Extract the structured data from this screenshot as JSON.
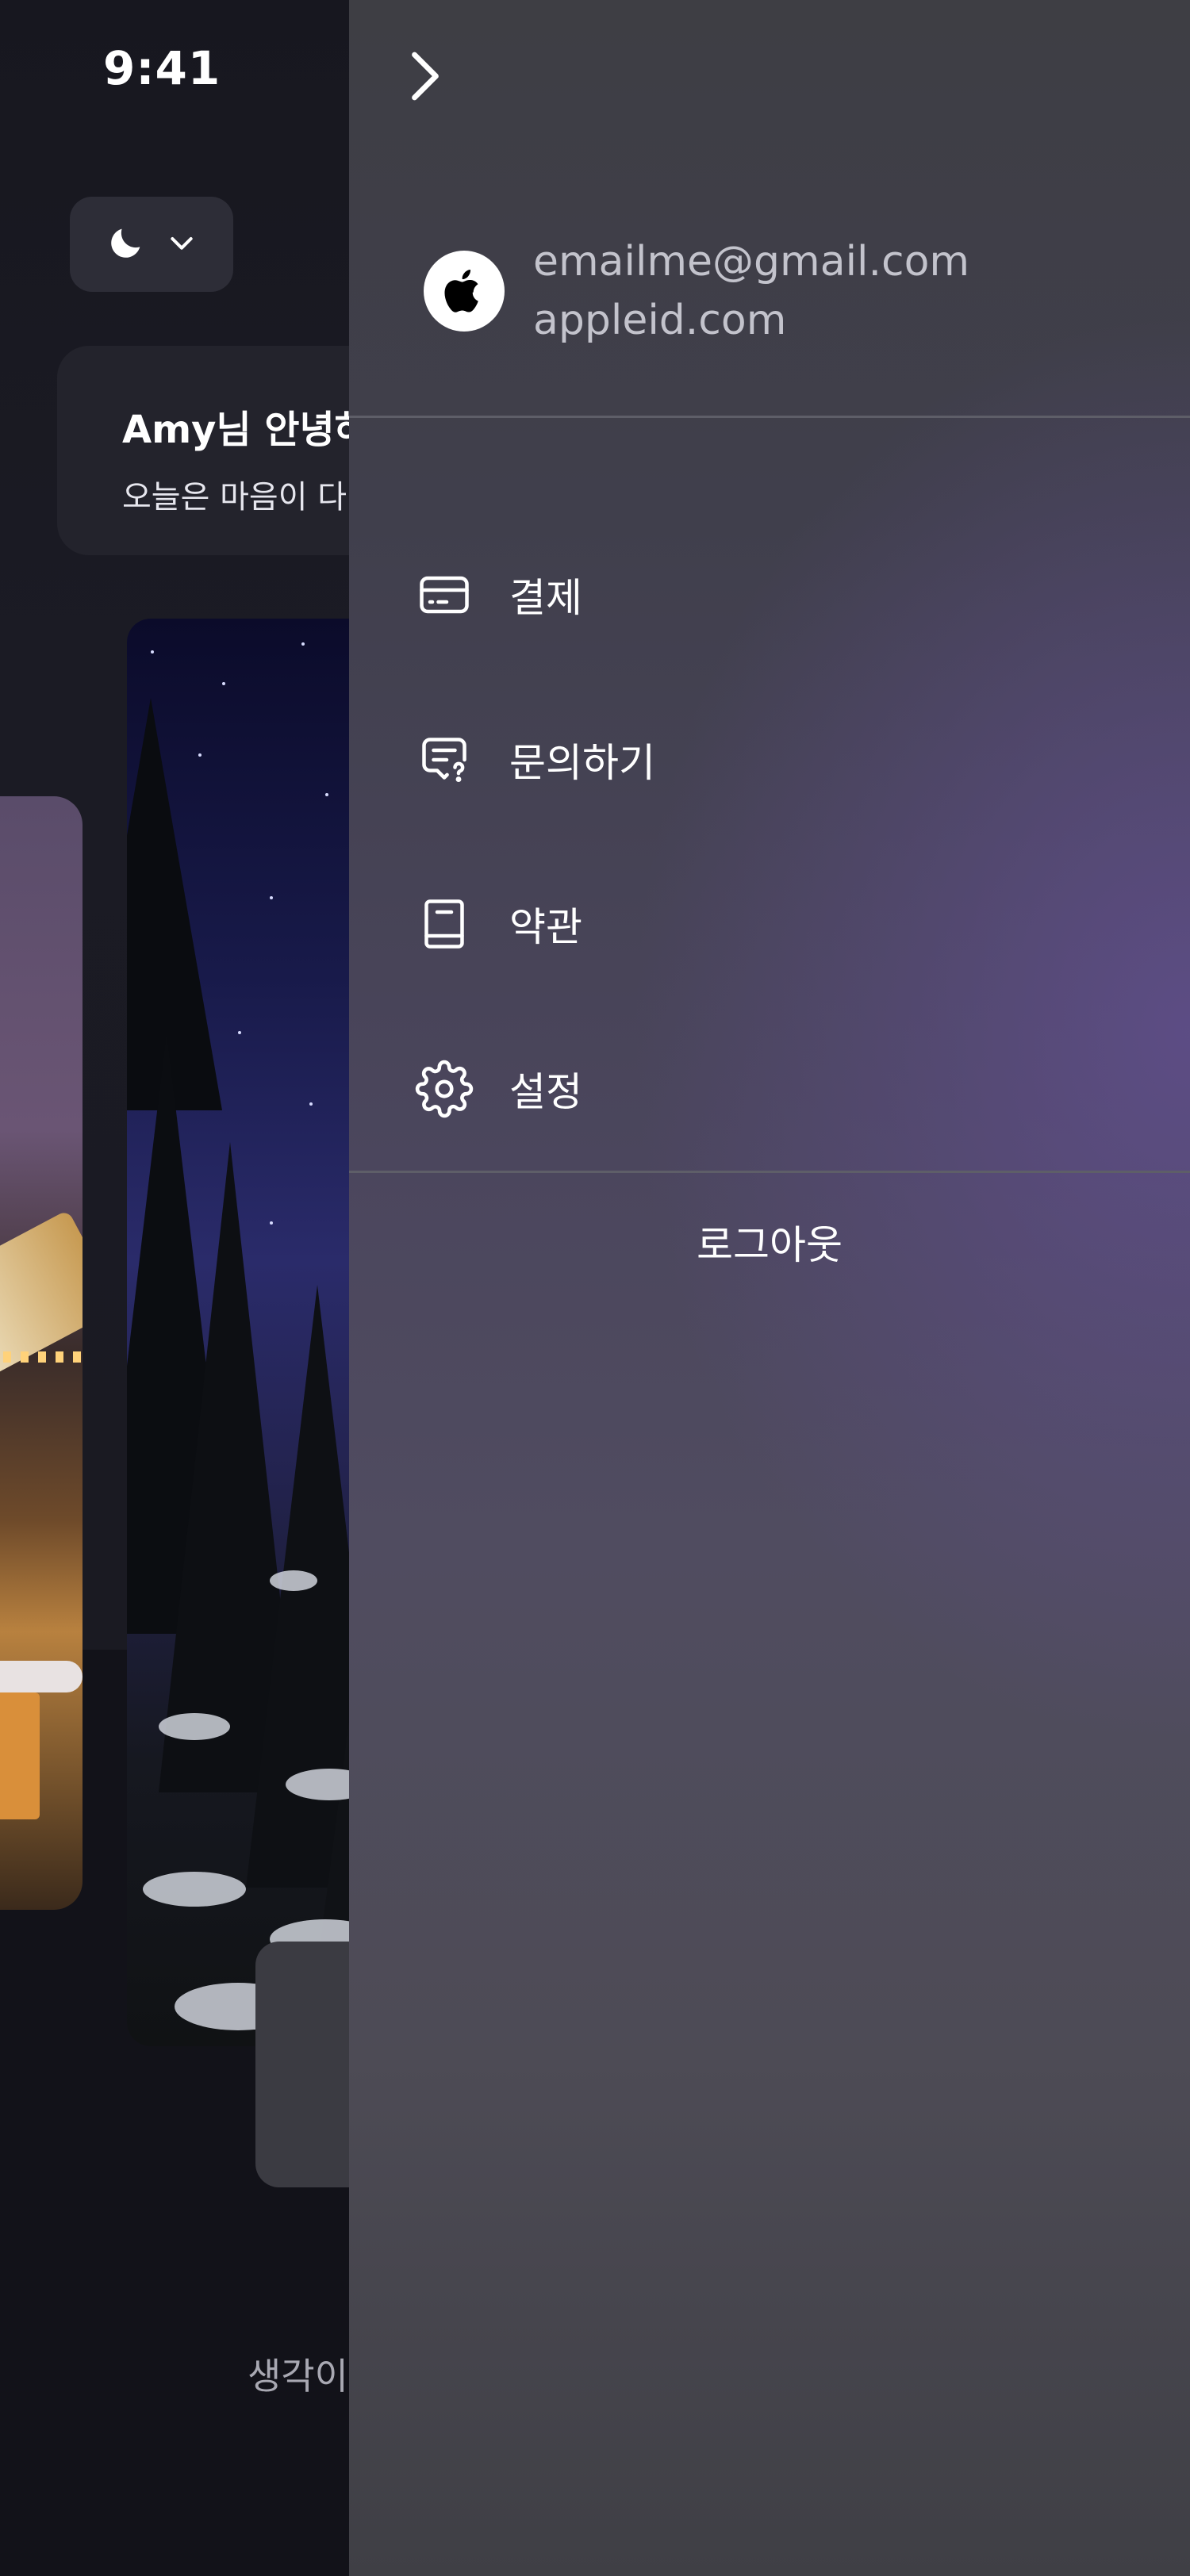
{
  "status_bar": {
    "time": "9:41"
  },
  "background": {
    "greeting_title": "Amy님 안녕하",
    "greeting_subtitle": "오늘은 마음이 다",
    "bottom_text": "생각이"
  },
  "drawer": {
    "account": {
      "email": "emailme@gmail.com",
      "domain": "appleid.com"
    },
    "menu": [
      {
        "label": "결제",
        "icon": "credit-card-icon"
      },
      {
        "label": "문의하기",
        "icon": "chat-question-icon"
      },
      {
        "label": "약관",
        "icon": "book-icon"
      },
      {
        "label": "설정",
        "icon": "gear-icon"
      }
    ],
    "logout_label": "로그아웃"
  },
  "colors": {
    "drawer_top": "#3e3e44",
    "drawer_accent": "#604e8c",
    "app_background": "#121219",
    "text_secondary": "#c3c3cc"
  }
}
